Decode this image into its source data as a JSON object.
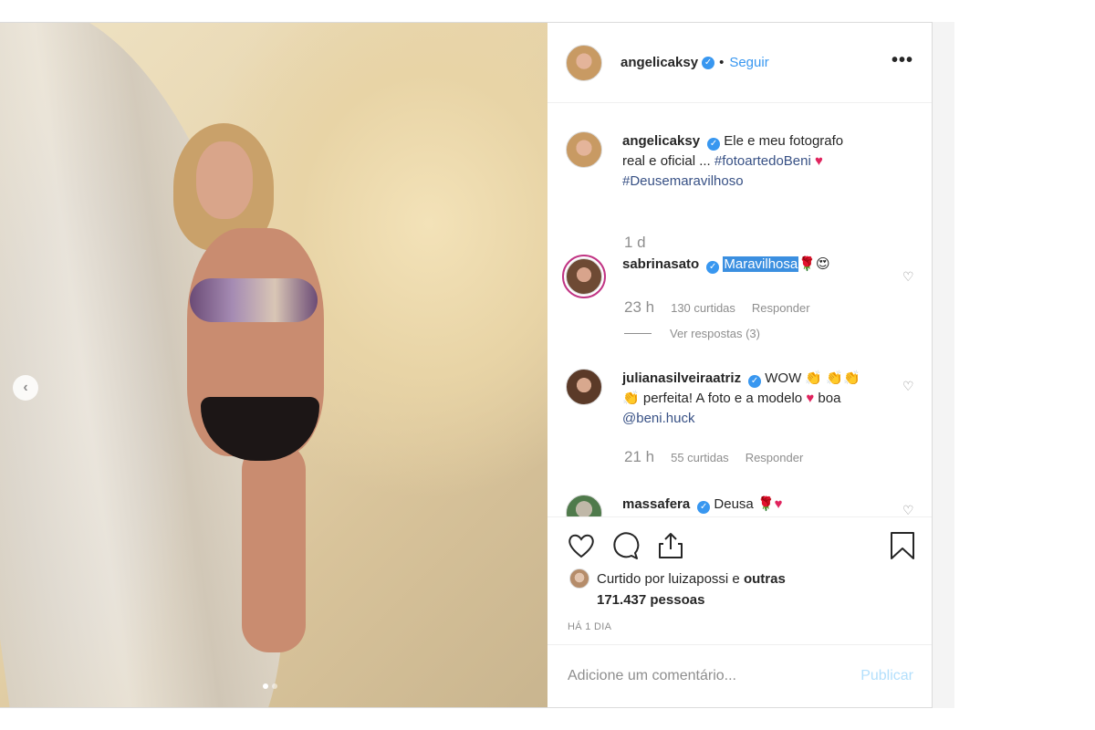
{
  "post": {
    "author": "angelicaksy",
    "follow_label": "Seguir",
    "more": "•••",
    "separator": "•"
  },
  "photo": {
    "carousel_prev": "‹"
  },
  "caption": {
    "username": "angelicaksy",
    "text_1": "Ele e meu fotografo real e oficial ... ",
    "hashtag_1": "#fotoartedoBeni",
    "heart": "♥",
    "hashtag_2": "#Deusemaravilhoso",
    "time": "1 d"
  },
  "comments": [
    {
      "username": "sabrinasato",
      "text": "Maravilhosa",
      "emoji_1": "🌹",
      "emoji_2": "😍",
      "time": "23 h",
      "likes": "130 curtidas",
      "reply_label": "Responder",
      "view_replies": "Ver respostas (3)"
    },
    {
      "username": "julianasilveiraatriz",
      "text_1": " WOW ",
      "claps": "👏",
      "claps_2": "👏👏👏",
      "text_2": " perfeita! A foto e a modelo ",
      "heart": "♥",
      "text_3": " boa ",
      "mention": "@beni.huck",
      "time": "21 h",
      "likes": "55 curtidas",
      "reply_label": "Responder"
    },
    {
      "username": "massafera",
      "text": " Deusa ",
      "emoji_1": "🌹",
      "heart": "♥"
    }
  ],
  "likes": {
    "prefix": "Curtido por ",
    "user": "luizapossi",
    "middle": " e",
    "others": "outras 171.437 pessoas"
  },
  "when": "HÁ 1 DIA",
  "add_comment": {
    "placeholder": "Adicione um comentário...",
    "publish": "Publicar"
  }
}
